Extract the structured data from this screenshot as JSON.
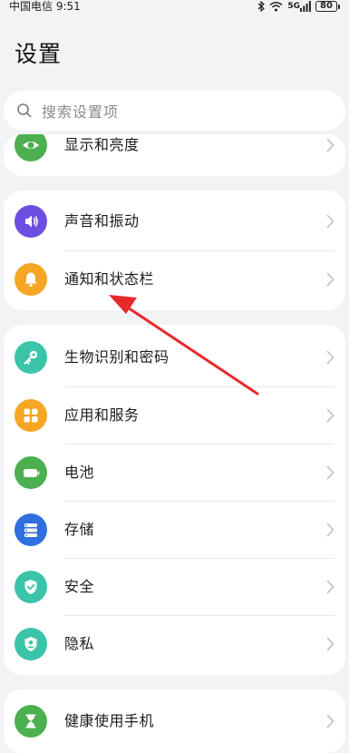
{
  "status_bar": {
    "carrier_time": "中国电信 9:51",
    "network_label": "5G",
    "battery_level": "80"
  },
  "title": "设置",
  "search": {
    "placeholder": "搜索设置项"
  },
  "groups": [
    {
      "items": [
        {
          "label": "显示和亮度",
          "icon": "display-brightness-icon",
          "color": "#4caf50"
        }
      ]
    },
    {
      "items": [
        {
          "label": "声音和振动",
          "icon": "speaker-icon",
          "color": "#6c4fe0"
        },
        {
          "label": "通知和状态栏",
          "icon": "bell-icon",
          "color": "#f5a623"
        }
      ]
    },
    {
      "items": [
        {
          "label": "生物识别和密码",
          "icon": "key-icon",
          "color": "#3cc4a8"
        },
        {
          "label": "应用和服务",
          "icon": "apps-grid-icon",
          "color": "#f5a623"
        },
        {
          "label": "电池",
          "icon": "battery-icon",
          "color": "#4caf50"
        },
        {
          "label": "存储",
          "icon": "storage-icon",
          "color": "#2f6fe0"
        },
        {
          "label": "安全",
          "icon": "shield-check-icon",
          "color": "#3cc4a8"
        },
        {
          "label": "隐私",
          "icon": "privacy-person-icon",
          "color": "#3cc4a8"
        }
      ]
    },
    {
      "items": [
        {
          "label": "健康使用手机",
          "icon": "hourglass-icon",
          "color": "#4caf50"
        }
      ]
    }
  ],
  "annotation": {
    "arrow_color": "#e8292c"
  }
}
